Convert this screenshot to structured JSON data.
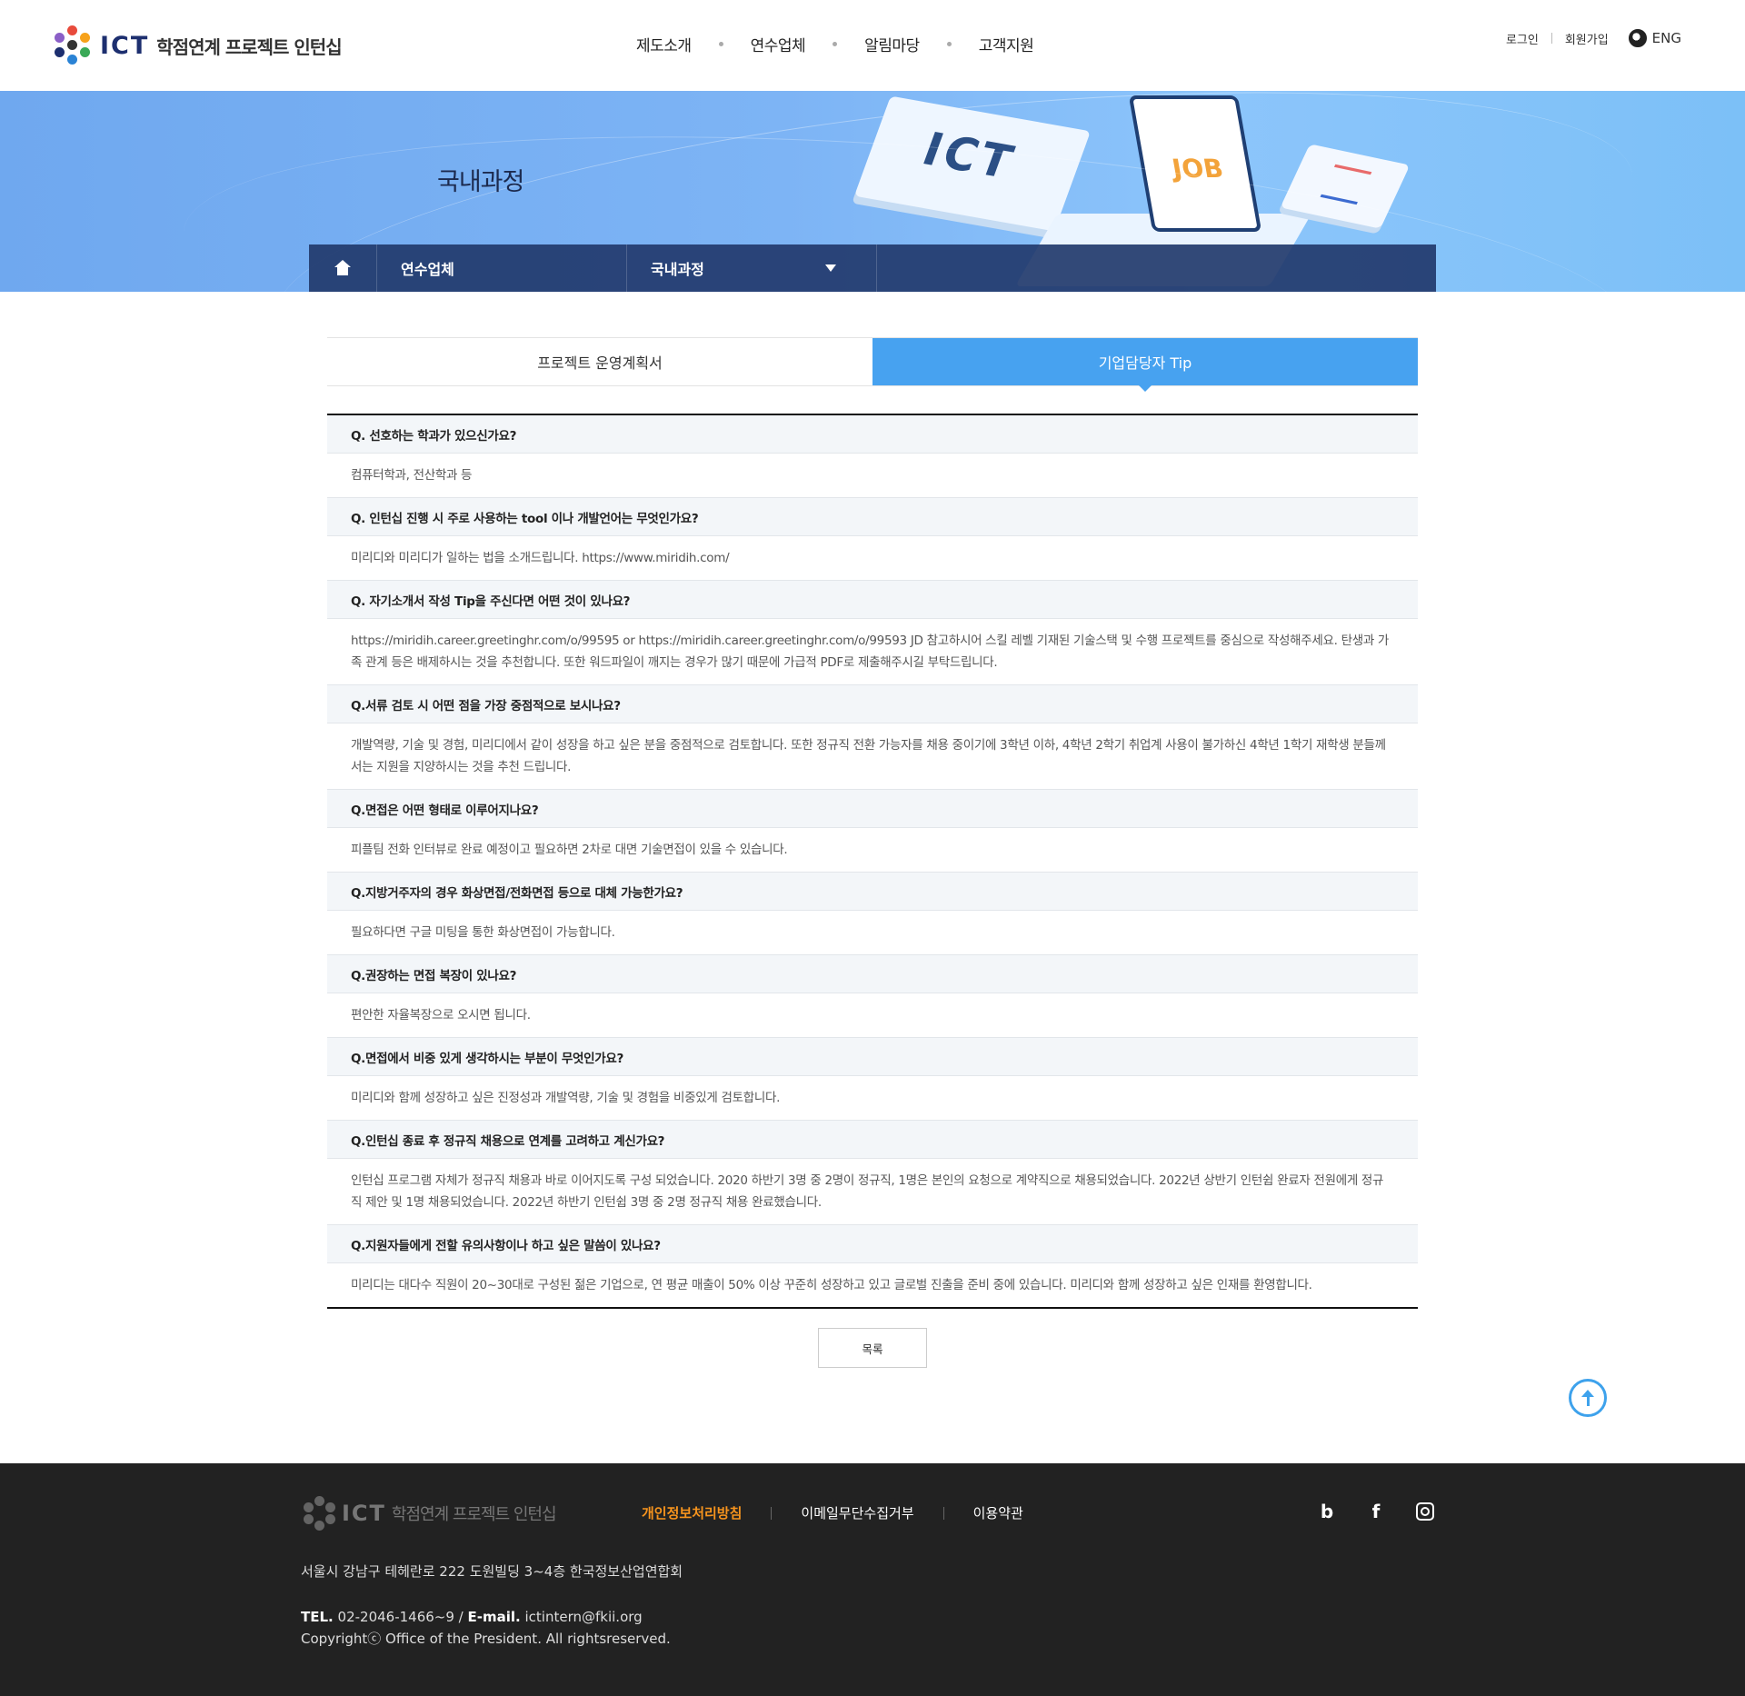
{
  "header": {
    "logo_ict": "ICT",
    "logo_text": "학점연계 프로젝트 인턴십",
    "nav": [
      "제도소개",
      "연수업체",
      "알림마당",
      "고객지원"
    ],
    "login": "로그인",
    "signup": "회원가입",
    "lang": "ENG"
  },
  "banner": {
    "title": "국내과정",
    "ict_word": "ICT",
    "job_word": "JOB"
  },
  "location": {
    "level1": "연수업체",
    "level2": "국내과정"
  },
  "tabs": [
    {
      "label": "프로젝트 운영계획서",
      "active": false
    },
    {
      "label": "기업담당자 Tip",
      "active": true
    }
  ],
  "faq": [
    {
      "q": "Q. 선호하는 학과가 있으신가요?",
      "a": "컴퓨터학과, 전산학과 등"
    },
    {
      "q": "Q. 인턴십 진행 시 주로 사용하는 tool 이나 개발언어는 무엇인가요?",
      "a": "미리디와 미리디가 일하는 법을 소개드립니다. https://www.miridih.com/"
    },
    {
      "q": "Q. 자기소개서 작성 Tip을 주신다면 어떤 것이 있나요?",
      "a": "https://miridih.career.greetinghr.com/o/99595 or https://miridih.career.greetinghr.com/o/99593 JD 참고하시어 스킬 레벨 기재된 기술스택 및 수행 프로젝트를 중심으로 작성해주세요. 탄생과 가족 관계 등은 배제하시는 것을 추천합니다. 또한 워드파일이 깨지는 경우가 많기 때문에 가급적 PDF로 제출해주시길 부탁드립니다."
    },
    {
      "q": "Q.서류 검토 시 어떤 점을 가장 중점적으로 보시나요?",
      "a": "개발역량, 기술 및 경험, 미리디에서 같이 성장을 하고 싶은 분을 중점적으로 검토합니다. 또한 정규직 전환 가능자를 채용 중이기에 3학년 이하, 4학년 2학기 취업계 사용이 불가하신 4학년 1학기 재학생 분들께서는 지원을 지양하시는 것을 추천 드립니다."
    },
    {
      "q": "Q.면접은 어떤 형태로 이루어지나요?",
      "a": "피플팀 전화 인터뷰로 완료 예정이고 필요하면 2차로 대면 기술면접이 있을 수 있습니다."
    },
    {
      "q": "Q.지방거주자의 경우 화상면접/전화면접 등으로 대체 가능한가요?",
      "a": "필요하다면 구글 미팅을 통한 화상면접이 가능합니다."
    },
    {
      "q": "Q.권장하는 면접 복장이 있나요?",
      "a": "편안한 자율복장으로 오시면 됩니다."
    },
    {
      "q": "Q.면접에서 비중 있게 생각하시는 부분이 무엇인가요?",
      "a": "미리디와 함께 성장하고 싶은 진정성과 개발역량, 기술 및 경험을 비중있게 검토합니다."
    },
    {
      "q": "Q.인턴십 종료 후 정규직 채용으로 연계를 고려하고 계신가요?",
      "a": "인턴십 프로그램 자체가 정규직 채용과 바로 이어지도록 구성 되었습니다. 2020 하반기 3명 중 2명이 정규직, 1명은 본인의 요청으로 계약직으로 채용되었습니다. 2022년 상반기 인턴쉽 완료자 전원에게 정규직 제안 및 1명 채용되었습니다. 2022년 하반기 인턴쉽 3명 중 2명 정규직 채용 완료했습니다."
    },
    {
      "q": "Q.지원자들에게 전할 유의사항이나 하고 싶은 말씀이 있나요?",
      "a": "미리디는 대다수 직원이 20~30대로 구성된 젊은 기업으로, 연 평균 매출이 50% 이상 꾸준히 성장하고 있고 글로벌 진출을 준비 중에 있습니다. 미리디와 함께 성장하고 싶은 인재를 환영합니다."
    }
  ],
  "list_button": "목록",
  "footer": {
    "logo_ict": "ICT",
    "logo_text": "학점연계 프로젝트 인턴십",
    "links": [
      "개인정보처리방침",
      "이메일무단수집거부",
      "이용약관"
    ],
    "address": "서울시 강남구 테헤란로 222 도원빌딩 3~4층 한국정보산업연합회",
    "tel_label": "TEL.",
    "tel": "02-2046-1466~9 /",
    "email_label": "E-mail.",
    "email": "ictintern@fkii.org",
    "copyright": "Copyrightⓒ Office of the President. All rightsreserved.",
    "social_b": "b",
    "social_f": "f"
  },
  "colors": {
    "accent": "#47a2f0",
    "locbar": "#223a6c",
    "footer_bg": "#222222",
    "footer_accent": "#f7941d"
  },
  "icons": [
    "home-icon",
    "chevron-down-icon",
    "globe-icon",
    "arrow-up-icon",
    "blog-icon",
    "facebook-icon",
    "instagram-icon"
  ]
}
